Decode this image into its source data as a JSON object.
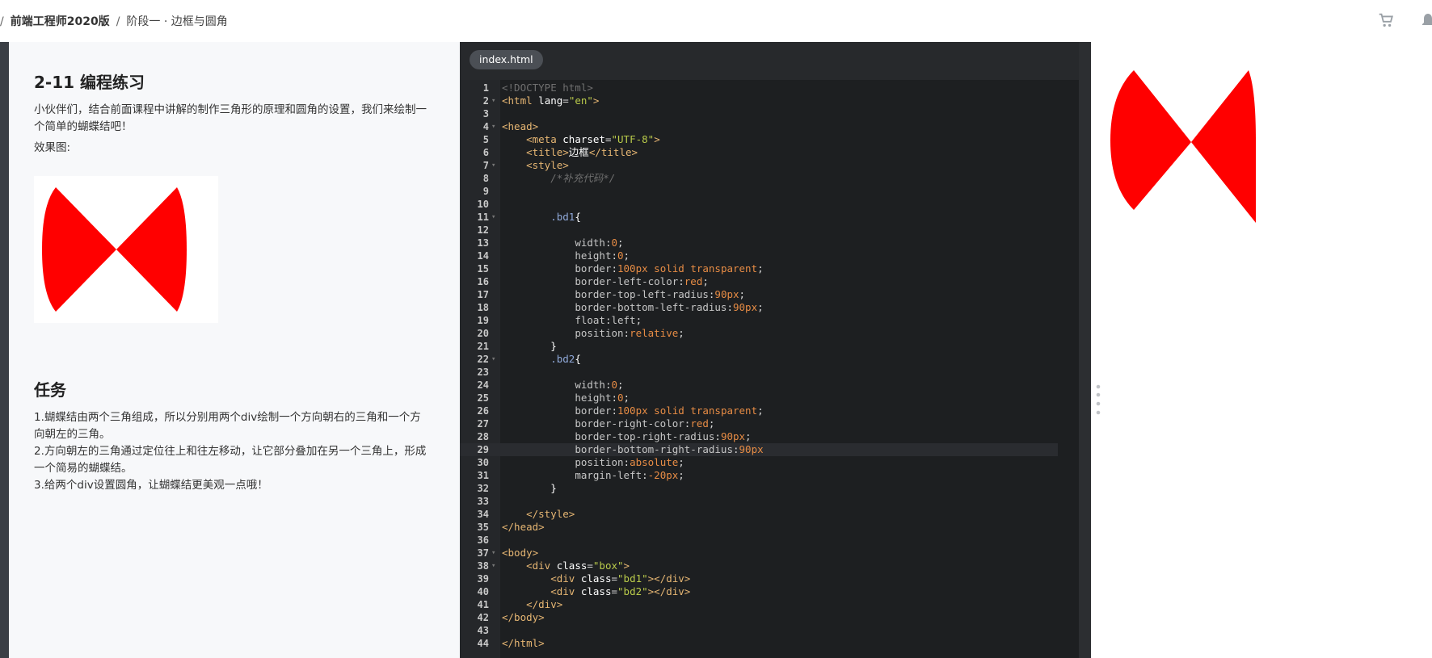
{
  "breadcrumb": {
    "sep1": "/",
    "course": "前端工程师2020版",
    "sep2": "/",
    "lesson": "阶段一 · 边框与圆角"
  },
  "header_icons": [
    "cart-icon",
    "bell-icon"
  ],
  "task": {
    "title": "2-11 编程练习",
    "intro": "小伙伴们，结合前面课程中讲解的制作三角形的原理和圆角的设置，我们来绘制一个简单的蝴蝶结吧！",
    "effect_label": "效果图:",
    "task_title": "任务",
    "steps": [
      "1.蝴蝶结由两个三角组成，所以分别用两个div绘制一个方向朝右的三角和一个方向朝左的三角。",
      "2.方向朝左的三角通过定位往上和往左移动，让它部分叠加在另一个三角上，形成一个简易的蝴蝶结。",
      "3.给两个div设置圆角，让蝴蝶结更美观一点哦！"
    ]
  },
  "editor": {
    "tab": "index.html",
    "active_line": 29,
    "lines": [
      {
        "n": "1",
        "fold": false,
        "tokens": [
          [
            "c-cm",
            "<!DOCTYPE html>"
          ]
        ]
      },
      {
        "n": "2",
        "fold": true,
        "tokens": [
          [
            "c-tag",
            "<html"
          ],
          [
            "c-attr",
            " lang"
          ],
          [
            "c-pun",
            "="
          ],
          [
            "c-str",
            "\"en\""
          ],
          [
            "c-tag",
            ">"
          ]
        ]
      },
      {
        "n": "3",
        "fold": false,
        "tokens": []
      },
      {
        "n": "4",
        "fold": true,
        "tokens": [
          [
            "c-tag",
            "<head>"
          ]
        ]
      },
      {
        "n": "5",
        "fold": false,
        "tokens": [
          [
            "c-pun",
            "    "
          ],
          [
            "c-tag",
            "<meta"
          ],
          [
            "c-attr",
            " charset"
          ],
          [
            "c-pun",
            "="
          ],
          [
            "c-str",
            "\"UTF-8\""
          ],
          [
            "c-tag",
            ">"
          ]
        ]
      },
      {
        "n": "6",
        "fold": false,
        "tokens": [
          [
            "c-pun",
            "    "
          ],
          [
            "c-tag",
            "<title>"
          ],
          [
            "c-txt",
            "边框"
          ],
          [
            "c-tag",
            "</title>"
          ]
        ]
      },
      {
        "n": "7",
        "fold": true,
        "tokens": [
          [
            "c-pun",
            "    "
          ],
          [
            "c-tag",
            "<style>"
          ]
        ]
      },
      {
        "n": "8",
        "fold": false,
        "tokens": [
          [
            "c-pun",
            "        "
          ],
          [
            "c-it",
            "/*补充代码*/"
          ]
        ]
      },
      {
        "n": "9",
        "fold": false,
        "tokens": []
      },
      {
        "n": "10",
        "fold": false,
        "tokens": []
      },
      {
        "n": "11",
        "fold": true,
        "tokens": [
          [
            "c-pun",
            "        "
          ],
          [
            "c-sel",
            ".bd1"
          ],
          [
            "c-txt",
            "{"
          ]
        ]
      },
      {
        "n": "12",
        "fold": false,
        "tokens": []
      },
      {
        "n": "13",
        "fold": false,
        "tokens": [
          [
            "c-pun",
            "            "
          ],
          [
            "c-prop",
            "width"
          ],
          [
            "c-pun",
            ":"
          ],
          [
            "c-num",
            "0"
          ],
          [
            "c-pun",
            ";"
          ]
        ]
      },
      {
        "n": "14",
        "fold": false,
        "tokens": [
          [
            "c-pun",
            "            "
          ],
          [
            "c-prop",
            "height"
          ],
          [
            "c-pun",
            ":"
          ],
          [
            "c-num",
            "0"
          ],
          [
            "c-pun",
            ";"
          ]
        ]
      },
      {
        "n": "15",
        "fold": false,
        "tokens": [
          [
            "c-pun",
            "            "
          ],
          [
            "c-prop",
            "border"
          ],
          [
            "c-pun",
            ":"
          ],
          [
            "c-num",
            "100px"
          ],
          [
            "c-kw",
            " solid transparent"
          ],
          [
            "c-pun",
            ";"
          ]
        ]
      },
      {
        "n": "16",
        "fold": false,
        "tokens": [
          [
            "c-pun",
            "            "
          ],
          [
            "c-prop",
            "border-left-color"
          ],
          [
            "c-pun",
            ":"
          ],
          [
            "c-kw",
            "red"
          ],
          [
            "c-pun",
            ";"
          ]
        ]
      },
      {
        "n": "17",
        "fold": false,
        "tokens": [
          [
            "c-pun",
            "            "
          ],
          [
            "c-prop",
            "border-top-left-radius"
          ],
          [
            "c-pun",
            ":"
          ],
          [
            "c-num",
            "90px"
          ],
          [
            "c-pun",
            ";"
          ]
        ]
      },
      {
        "n": "18",
        "fold": false,
        "tokens": [
          [
            "c-pun",
            "            "
          ],
          [
            "c-prop",
            "border-bottom-left-radius"
          ],
          [
            "c-pun",
            ":"
          ],
          [
            "c-num",
            "90px"
          ],
          [
            "c-pun",
            ";"
          ]
        ]
      },
      {
        "n": "19",
        "fold": false,
        "tokens": [
          [
            "c-pun",
            "            "
          ],
          [
            "c-prop",
            "float"
          ],
          [
            "c-pun",
            ":"
          ],
          [
            "c-prop",
            "left"
          ],
          [
            "c-pun",
            ";"
          ]
        ]
      },
      {
        "n": "20",
        "fold": false,
        "tokens": [
          [
            "c-pun",
            "            "
          ],
          [
            "c-prop",
            "position"
          ],
          [
            "c-pun",
            ":"
          ],
          [
            "c-kw",
            "relative"
          ],
          [
            "c-pun",
            ";"
          ]
        ]
      },
      {
        "n": "21",
        "fold": false,
        "tokens": [
          [
            "c-pun",
            "        "
          ],
          [
            "c-txt",
            "}"
          ]
        ]
      },
      {
        "n": "22",
        "fold": true,
        "tokens": [
          [
            "c-pun",
            "        "
          ],
          [
            "c-sel",
            ".bd2"
          ],
          [
            "c-txt",
            "{"
          ]
        ]
      },
      {
        "n": "23",
        "fold": false,
        "tokens": []
      },
      {
        "n": "24",
        "fold": false,
        "tokens": [
          [
            "c-pun",
            "            "
          ],
          [
            "c-prop",
            "width"
          ],
          [
            "c-pun",
            ":"
          ],
          [
            "c-num",
            "0"
          ],
          [
            "c-pun",
            ";"
          ]
        ]
      },
      {
        "n": "25",
        "fold": false,
        "tokens": [
          [
            "c-pun",
            "            "
          ],
          [
            "c-prop",
            "height"
          ],
          [
            "c-pun",
            ":"
          ],
          [
            "c-num",
            "0"
          ],
          [
            "c-pun",
            ";"
          ]
        ]
      },
      {
        "n": "26",
        "fold": false,
        "tokens": [
          [
            "c-pun",
            "            "
          ],
          [
            "c-prop",
            "border"
          ],
          [
            "c-pun",
            ":"
          ],
          [
            "c-num",
            "100px"
          ],
          [
            "c-kw",
            " solid transparent"
          ],
          [
            "c-pun",
            ";"
          ]
        ]
      },
      {
        "n": "27",
        "fold": false,
        "tokens": [
          [
            "c-pun",
            "            "
          ],
          [
            "c-prop",
            "border-right-color"
          ],
          [
            "c-pun",
            ":"
          ],
          [
            "c-kw",
            "red"
          ],
          [
            "c-pun",
            ";"
          ]
        ]
      },
      {
        "n": "28",
        "fold": false,
        "tokens": [
          [
            "c-pun",
            "            "
          ],
          [
            "c-prop",
            "border-top-right-radius"
          ],
          [
            "c-pun",
            ":"
          ],
          [
            "c-num",
            "90px"
          ],
          [
            "c-pun",
            ";"
          ]
        ]
      },
      {
        "n": "29",
        "fold": false,
        "tokens": [
          [
            "c-pun",
            "            "
          ],
          [
            "c-prop",
            "border-bottom-right-radius"
          ],
          [
            "c-pun",
            ":"
          ],
          [
            "c-num",
            "90px"
          ]
        ]
      },
      {
        "n": "30",
        "fold": false,
        "tokens": [
          [
            "c-pun",
            "            "
          ],
          [
            "c-prop",
            "position"
          ],
          [
            "c-pun",
            ":"
          ],
          [
            "c-kw",
            "absolute"
          ],
          [
            "c-pun",
            ";"
          ]
        ]
      },
      {
        "n": "31",
        "fold": false,
        "tokens": [
          [
            "c-pun",
            "            "
          ],
          [
            "c-prop",
            "margin-left"
          ],
          [
            "c-pun",
            ":"
          ],
          [
            "c-num",
            "-20px"
          ],
          [
            "c-pun",
            ";"
          ]
        ]
      },
      {
        "n": "32",
        "fold": false,
        "tokens": [
          [
            "c-pun",
            "        "
          ],
          [
            "c-txt",
            "}"
          ]
        ]
      },
      {
        "n": "33",
        "fold": false,
        "tokens": []
      },
      {
        "n": "34",
        "fold": false,
        "tokens": [
          [
            "c-pun",
            "    "
          ],
          [
            "c-tag",
            "</style>"
          ]
        ]
      },
      {
        "n": "35",
        "fold": false,
        "tokens": [
          [
            "c-tag",
            "</head>"
          ]
        ]
      },
      {
        "n": "36",
        "fold": false,
        "tokens": []
      },
      {
        "n": "37",
        "fold": true,
        "tokens": [
          [
            "c-tag",
            "<body>"
          ]
        ]
      },
      {
        "n": "38",
        "fold": true,
        "tokens": [
          [
            "c-pun",
            "    "
          ],
          [
            "c-tag",
            "<div"
          ],
          [
            "c-attr",
            " class"
          ],
          [
            "c-pun",
            "="
          ],
          [
            "c-str",
            "\"box\""
          ],
          [
            "c-tag",
            ">"
          ]
        ]
      },
      {
        "n": "39",
        "fold": false,
        "tokens": [
          [
            "c-pun",
            "        "
          ],
          [
            "c-tag",
            "<div"
          ],
          [
            "c-attr",
            " class"
          ],
          [
            "c-pun",
            "="
          ],
          [
            "c-str",
            "\"bd1\""
          ],
          [
            "c-tag",
            "></div>"
          ]
        ]
      },
      {
        "n": "40",
        "fold": false,
        "tokens": [
          [
            "c-pun",
            "        "
          ],
          [
            "c-tag",
            "<div"
          ],
          [
            "c-attr",
            " class"
          ],
          [
            "c-pun",
            "="
          ],
          [
            "c-str",
            "\"bd2\""
          ],
          [
            "c-tag",
            "></div>"
          ]
        ]
      },
      {
        "n": "41",
        "fold": false,
        "tokens": [
          [
            "c-pun",
            "    "
          ],
          [
            "c-tag",
            "</div>"
          ]
        ]
      },
      {
        "n": "42",
        "fold": false,
        "tokens": [
          [
            "c-tag",
            "</body>"
          ]
        ]
      },
      {
        "n": "43",
        "fold": false,
        "tokens": []
      },
      {
        "n": "44",
        "fold": false,
        "tokens": [
          [
            "c-tag",
            "</html>"
          ]
        ]
      }
    ]
  },
  "colors": {
    "bow": "#ff0000",
    "editor_bg": "#1d1f21",
    "panel_bg": "#f7f8fa"
  }
}
